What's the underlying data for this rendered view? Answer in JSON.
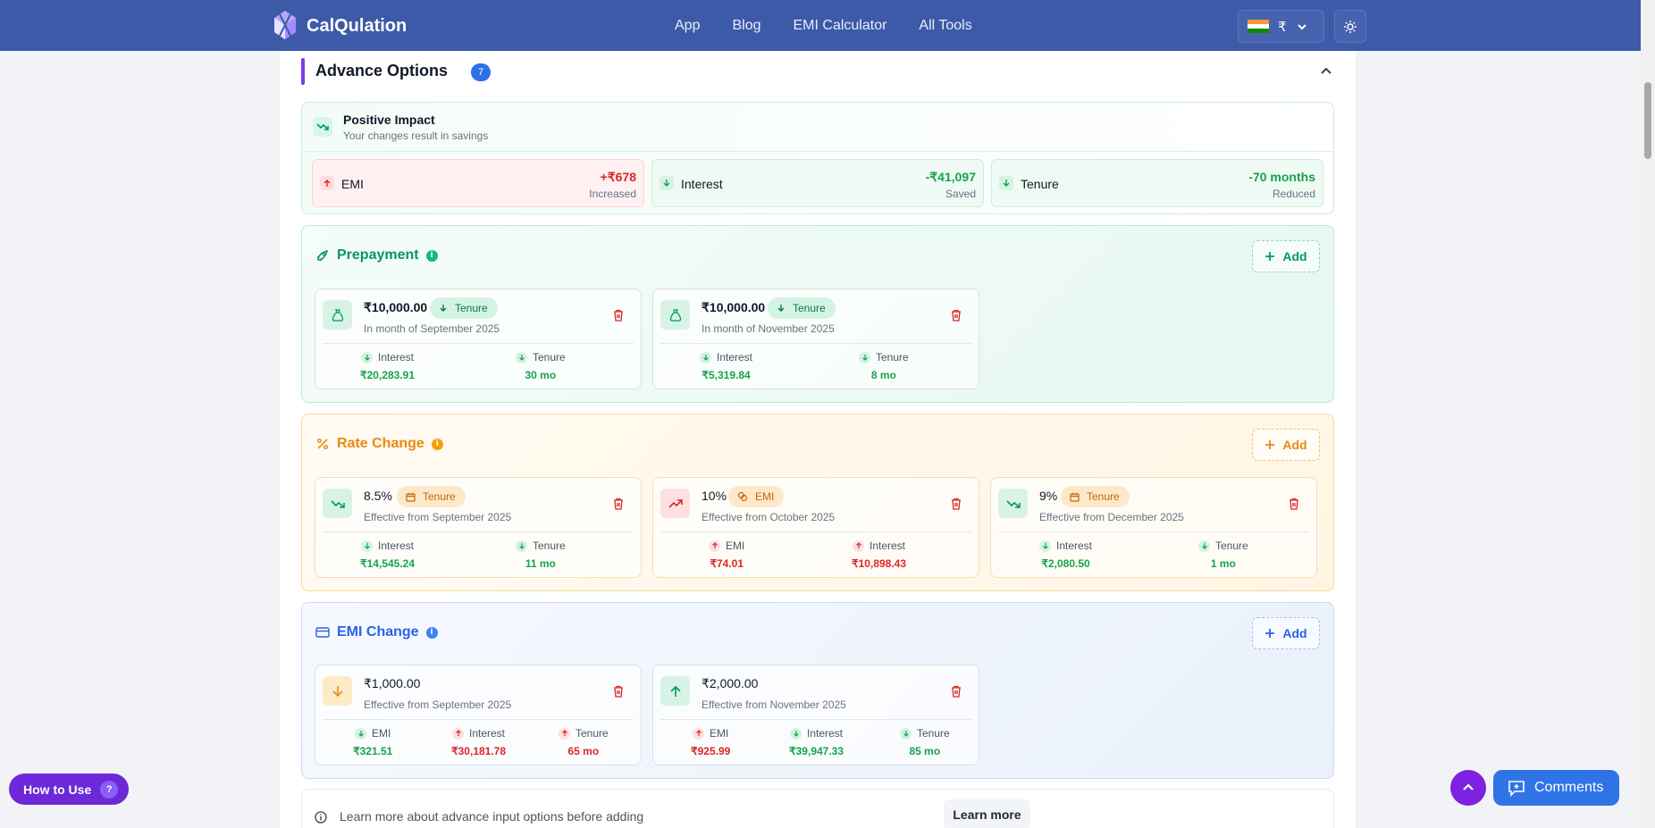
{
  "header": {
    "brand": "CalQulation",
    "nav": [
      "App",
      "Blog",
      "EMI Calculator",
      "All Tools"
    ],
    "currency_symbol": "₹",
    "currency_flag": "india-flag",
    "theme_icon": "sun-icon"
  },
  "advance": {
    "title": "Advance Options",
    "count": "7"
  },
  "impact": {
    "title": "Positive Impact",
    "subtitle": "Your changes result in savings",
    "metrics": [
      {
        "label": "EMI",
        "value": "+₹678",
        "note": "Increased",
        "tone": "red"
      },
      {
        "label": "Interest",
        "value": "-₹41,097",
        "note": "Saved",
        "tone": "green"
      },
      {
        "label": "Tenure",
        "value": "-70 months",
        "note": "Reduced",
        "tone": "green"
      }
    ]
  },
  "prepayment": {
    "title": "Prepayment",
    "add_label": "Add",
    "items": [
      {
        "amount": "₹10,000.00",
        "tag": "Tenure",
        "date": "In month of September 2025",
        "stat1_label": "Interest",
        "stat1_value": "₹20,283.91",
        "stat2_label": "Tenure",
        "stat2_value": "30 mo"
      },
      {
        "amount": "₹10,000.00",
        "tag": "Tenure",
        "date": "In month of November 2025",
        "stat1_label": "Interest",
        "stat1_value": "₹5,319.84",
        "stat2_label": "Tenure",
        "stat2_value": "8 mo"
      }
    ]
  },
  "rate_change": {
    "title": "Rate Change",
    "add_label": "Add",
    "items": [
      {
        "rate": "8.5%",
        "tag": "Tenure",
        "date": "Effective from September 2025",
        "stat1_label": "Interest",
        "stat1_value": "₹14,545.24",
        "stat2_label": "Tenure",
        "stat2_value": "11 mo"
      },
      {
        "rate": "10%",
        "tag": "EMI",
        "date": "Effective from October 2025",
        "stat1_label": "EMI",
        "stat1_value": "₹74.01",
        "stat2_label": "Interest",
        "stat2_value": "₹10,898.43"
      },
      {
        "rate": "9%",
        "tag": "Tenure",
        "date": "Effective from December 2025",
        "stat1_label": "Interest",
        "stat1_value": "₹2,080.50",
        "stat2_label": "Tenure",
        "stat2_value": "1 mo"
      }
    ]
  },
  "emi_change": {
    "title": "EMI Change",
    "add_label": "Add",
    "items": [
      {
        "amount": "₹1,000.00",
        "date": "Effective from September 2025",
        "stat1_label": "EMI",
        "stat1_value": "₹321.51",
        "stat2_label": "Interest",
        "stat2_value": "₹30,181.78",
        "stat3_label": "Tenure",
        "stat3_value": "65 mo"
      },
      {
        "amount": "₹2,000.00",
        "date": "Effective from November 2025",
        "stat1_label": "EMI",
        "stat1_value": "₹925.99",
        "stat2_label": "Interest",
        "stat2_value": "₹39,947.33",
        "stat3_label": "Tenure",
        "stat3_value": "85 mo"
      }
    ]
  },
  "note": {
    "text": "Learn more about advance input options before adding",
    "button": "Learn more"
  },
  "floating": {
    "how_to_use": "How to Use",
    "how_to_use_badge": "?",
    "comments": "Comments"
  },
  "colors": {
    "header_bg": "#3d5aa8",
    "green": "#16a34a",
    "red": "#dc2626",
    "amber": "#ea8a10",
    "blue": "#2563eb",
    "purple": "#7c22e0"
  }
}
